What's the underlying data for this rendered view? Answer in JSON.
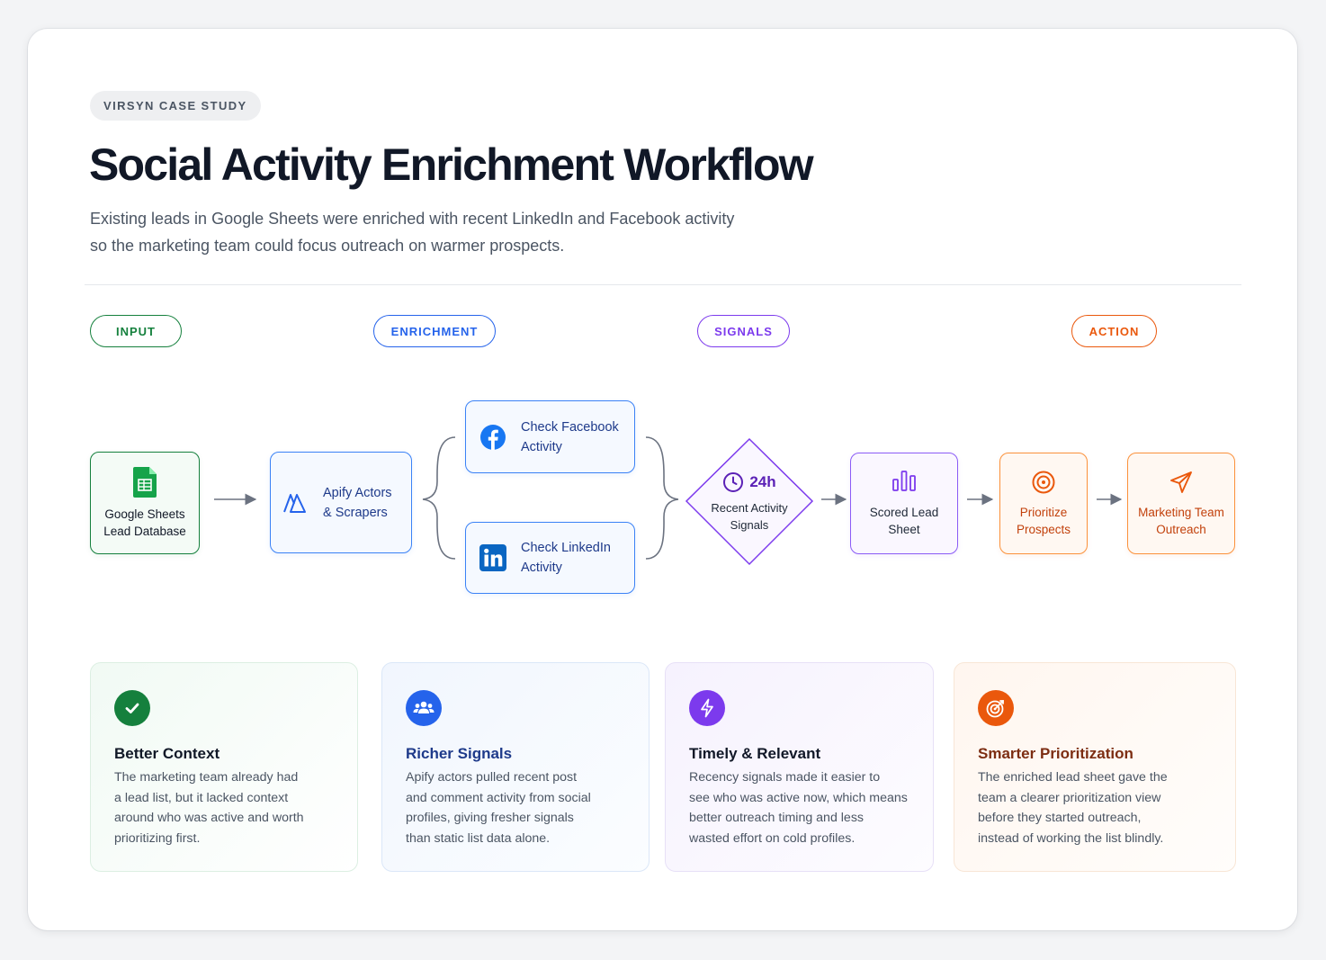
{
  "eyebrow": "VIRSYN CASE STUDY",
  "title": "Social Activity Enrichment Workflow",
  "subtitle_lines": [
    "Existing leads in Google Sheets were enriched with recent LinkedIn and Facebook activity",
    "so the marketing team could focus outreach on warmer prospects."
  ],
  "stages": {
    "input": "INPUT",
    "enrichment": "ENRICHMENT",
    "signals": "SIGNALS",
    "action": "ACTION"
  },
  "nodes": {
    "sheets": {
      "lines": [
        "Google Sheets",
        "Lead Database"
      ],
      "icon": "google-sheets-icon"
    },
    "apify": {
      "lines": [
        "Apify Actors",
        "& Scrapers"
      ],
      "icon": "apify-icon"
    },
    "facebook": {
      "lines": [
        "Check Facebook",
        "Activity"
      ],
      "icon": "facebook-icon"
    },
    "linkedin": {
      "lines": [
        "Check LinkedIn",
        "Activity"
      ],
      "icon": "linkedin-icon"
    },
    "signals": {
      "badge": "24h",
      "lines": [
        "Recent Activity",
        "Signals"
      ],
      "icon": "clock-icon"
    },
    "scored": {
      "lines": [
        "Scored Lead",
        "Sheet"
      ],
      "icon": "bar-chart-icon"
    },
    "prioritize": {
      "lines": [
        "Prioritize",
        "Prospects"
      ],
      "icon": "target-icon"
    },
    "outreach": {
      "lines": [
        "Marketing Team",
        "Outreach"
      ],
      "icon": "send-icon"
    }
  },
  "cards": [
    {
      "title": "Better Context",
      "icon": "check-icon",
      "lines": [
        "The marketing team already had",
        "a lead list, but it lacked context",
        "around who was active and worth",
        "prioritizing first."
      ]
    },
    {
      "title": "Richer Signals",
      "icon": "users-icon",
      "lines": [
        "Apify actors pulled recent post",
        "and comment activity from social",
        "profiles, giving fresher signals",
        "than static list data alone."
      ]
    },
    {
      "title": "Timely & Relevant",
      "icon": "lightning-icon",
      "lines": [
        "Recency signals made it easier to",
        "see who was active now, which means",
        "better outreach timing and less",
        "wasted effort on cold profiles."
      ]
    },
    {
      "title": "Smarter Prioritization",
      "icon": "target-icon",
      "lines": [
        "The enriched lead sheet gave the",
        "team a clearer prioritization view",
        "before they started outreach,",
        "instead of working the list blindly."
      ]
    }
  ],
  "colors": {
    "green": "#15803d",
    "blue": "#2563eb",
    "purple": "#7c3aed",
    "orange": "#ea580c",
    "title": "#111827"
  }
}
